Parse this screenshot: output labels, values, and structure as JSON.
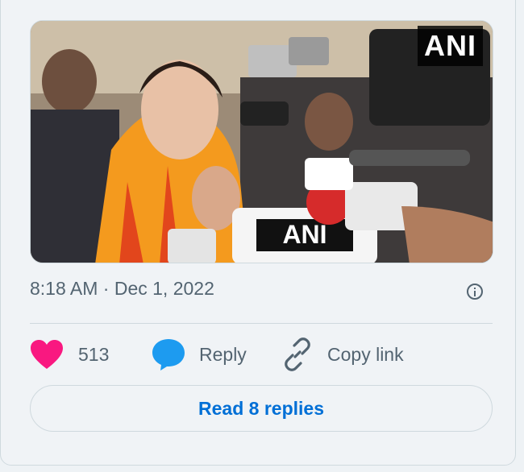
{
  "tweet": {
    "media": {
      "watermark": "ANI",
      "description": "news video still"
    },
    "time": "8:18 AM",
    "separator": "·",
    "date": "Dec 1, 2022",
    "actions": {
      "like_count": "513",
      "reply_label": "Reply",
      "copy_label": "Copy link"
    },
    "read_replies_label": "Read 8 replies"
  },
  "icons": {
    "info": "info-icon",
    "heart": "heart-icon",
    "reply": "reply-bubble-icon",
    "link": "link-icon"
  },
  "colors": {
    "heart": "#f91880",
    "reply_bubble": "#1d9bf0",
    "link_text": "#006fd6",
    "muted_text": "#536471"
  }
}
